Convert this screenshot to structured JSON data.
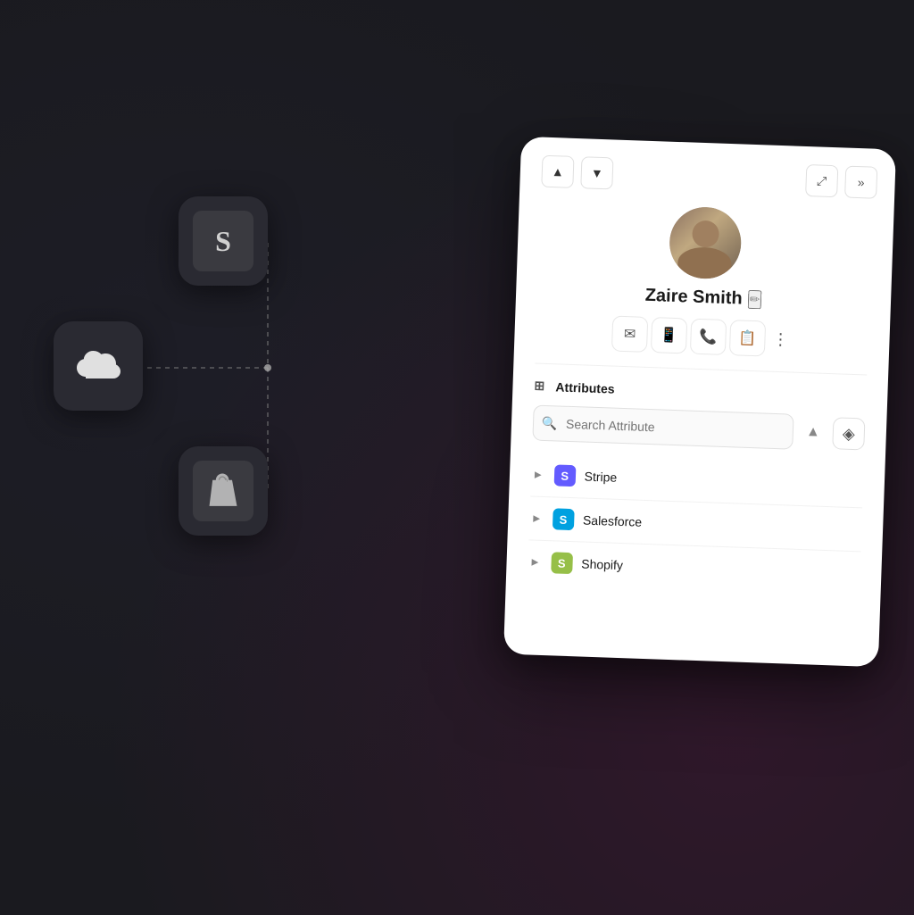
{
  "background": {
    "color": "#1a1a1f"
  },
  "icons": [
    {
      "id": "salesforce",
      "label": "Salesforce",
      "type": "cloud",
      "position": "left-middle"
    },
    {
      "id": "squarespace",
      "label": "Squarespace",
      "type": "letter-S",
      "letter": "S",
      "position": "top-center"
    },
    {
      "id": "shopify",
      "label": "Shopify",
      "type": "bag",
      "position": "bottom-center"
    }
  ],
  "card": {
    "nav": {
      "up_label": "▲",
      "down_label": "▼"
    },
    "top_right": {
      "expand_label": "⤢",
      "forward_label": "»"
    },
    "user": {
      "name": "Zaire Smith",
      "edit_icon": "✏"
    },
    "actions": [
      {
        "id": "email",
        "icon": "✉",
        "label": "Email"
      },
      {
        "id": "device",
        "icon": "📱",
        "label": "Device"
      },
      {
        "id": "phone",
        "icon": "📞",
        "label": "Phone"
      },
      {
        "id": "note",
        "icon": "📋",
        "label": "Note"
      }
    ],
    "more_label": "⋮",
    "attributes_section": {
      "icon": "⊞",
      "title": "Attributes"
    },
    "search": {
      "placeholder": "Search Attribute",
      "collapse_label": "▲",
      "add_label": "◈"
    },
    "integrations": [
      {
        "id": "stripe",
        "name": "Stripe",
        "logo_letter": "S",
        "logo_color": "#635bff"
      },
      {
        "id": "salesforce",
        "name": "Salesforce",
        "logo_letter": "S",
        "logo_color": "#00a1e0"
      },
      {
        "id": "shopify",
        "name": "Shopify",
        "logo_letter": "S",
        "logo_color": "#96bf48"
      }
    ]
  }
}
